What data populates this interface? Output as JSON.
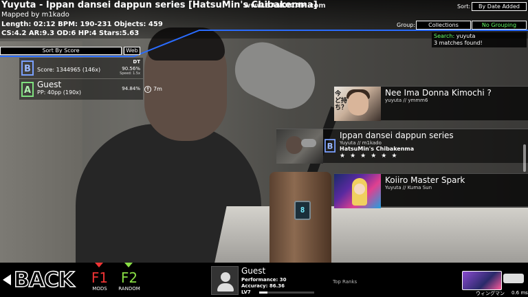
{
  "watermark": "www.BANDICAM.com",
  "beatmap": {
    "title": "Yuyuta - Ippan dansei dappun series [HatsuMin's Chibakenma]",
    "mapped_by": "Mapped by m1kado",
    "length_line": "Length: 02:12 BPM: 190-231 Objects: 459",
    "stats_line": "CS:4.2 AR:9.3 OD:6 HP:4 Stars:5.63"
  },
  "sort": {
    "label": "Sort:",
    "value": "By Date Added"
  },
  "group": {
    "label": "Group:",
    "collections": "Collections",
    "value": "No Grouping"
  },
  "search": {
    "label": "Search:",
    "query": "yuyuta",
    "matches": "3 matches found!"
  },
  "leaderboard": {
    "sort_button": "Sort By Score",
    "web_button": "Web",
    "scores": [
      {
        "name": "",
        "score": "Score: 1344965 (146x)",
        "mods": "DT",
        "accuracy": "90.56%",
        "speed": "Speed: 1.5x"
      },
      {
        "name": "Guest",
        "score": "PP: 40pp (190x)",
        "accuracy": "94.84%",
        "time": "7m"
      }
    ]
  },
  "songs": [
    {
      "title": "Nee Ima Donna Kimochi ?",
      "artist": "yuyuta // ymmm6",
      "thumb_text": "今 ど持ち？"
    },
    {
      "title": "Ippan dansei dappun series",
      "artist": "Yuyuta // m1kado",
      "diff": "HatsuMin's Chibakenma",
      "stars": "★★★★★★"
    },
    {
      "title": "Koiiro Master Spark",
      "artist": "Yuyuta // Kuma Sun"
    }
  ],
  "bottom": {
    "back": "BACK",
    "f1": {
      "key": "F1",
      "label": "MODS"
    },
    "f2": {
      "key": "F2",
      "label": "RANDOM"
    },
    "user": {
      "name": "Guest",
      "performance": "Performance: 30",
      "accuracy": "Accuracy: 86.36",
      "level": "LV7",
      "level_progress": 0.15
    },
    "top_ranks": "Top Ranks",
    "character": "ウィングマン",
    "ms": "0.6 ms"
  },
  "gun_display": "8",
  "colors": {
    "accent_blue": "#2a6cff",
    "green": "#66ff66",
    "mods_red": "#ee3333",
    "random_green": "#88dd44"
  }
}
